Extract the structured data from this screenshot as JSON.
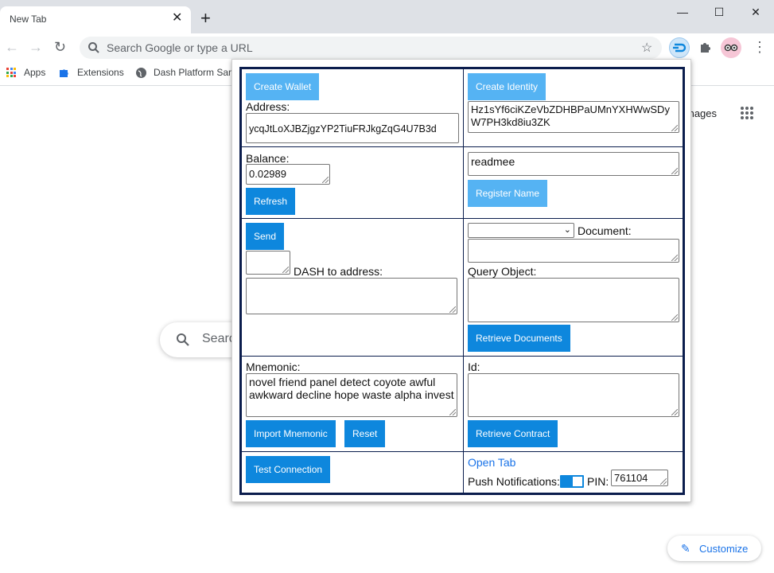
{
  "browser": {
    "tab_title": "New Tab",
    "tab_close": "✕",
    "new_tab": "+",
    "window_controls": {
      "minimize": "—",
      "maximize": "☐",
      "close": "✕"
    },
    "omnibox_placeholder": "Search Google or type a URL",
    "bookmarks": [
      "Apps",
      "Extensions",
      "Dash Platform Sam"
    ],
    "google_search_placeholder": "Searc",
    "images_link": "mages",
    "customize_label": "Customize",
    "icons": [
      "back-icon",
      "forward-icon",
      "reload-icon",
      "search-icon",
      "star-icon",
      "dash-extension-icon",
      "puzzle-icon",
      "avatar-icon",
      "menu-icon"
    ]
  },
  "popup": {
    "create_wallet": "Create Wallet",
    "address_label": "Address:",
    "address_value": "ycqJtLoXJBZjgzYP2TiuFRJkgZqG4U7B3d",
    "create_identity": "Create Identity",
    "identity_value": "Hz1sYf6ciKZeVbZDHBPaUMnYXHWwSDyW7PH3kd8iu3ZK",
    "balance_label": "Balance:",
    "balance_value": "0.02989",
    "refresh": "Refresh",
    "name_value": "readmee",
    "register_name": "Register Name",
    "send": "Send",
    "amount_value": "",
    "dash_to_address_label": "DASH to address:",
    "to_address_value": "",
    "contract_select_value": "",
    "document_label": "Document:",
    "document_value": "",
    "query_object_label": "Query Object:",
    "query_value": "",
    "retrieve_documents": "Retrieve Documents",
    "mnemonic_label": "Mnemonic:",
    "mnemonic_value": "novel friend panel detect coyote awful awkward decline hope waste alpha invest",
    "import_mnemonic": "Import Mnemonic",
    "reset": "Reset",
    "id_label": "Id:",
    "id_value": "",
    "retrieve_contract": "Retrieve Contract",
    "test_connection": "Test Connection",
    "open_tab": "Open Tab",
    "push_notifications_label": "Push Notifications:",
    "push_notifications_on": true,
    "pin_label": "PIN:",
    "pin_value": "761104"
  },
  "colors": {
    "button": "#0e87dd",
    "button_light": "#55b3f3",
    "table_border": "#0b1d4d",
    "link": "#1a73e8"
  }
}
